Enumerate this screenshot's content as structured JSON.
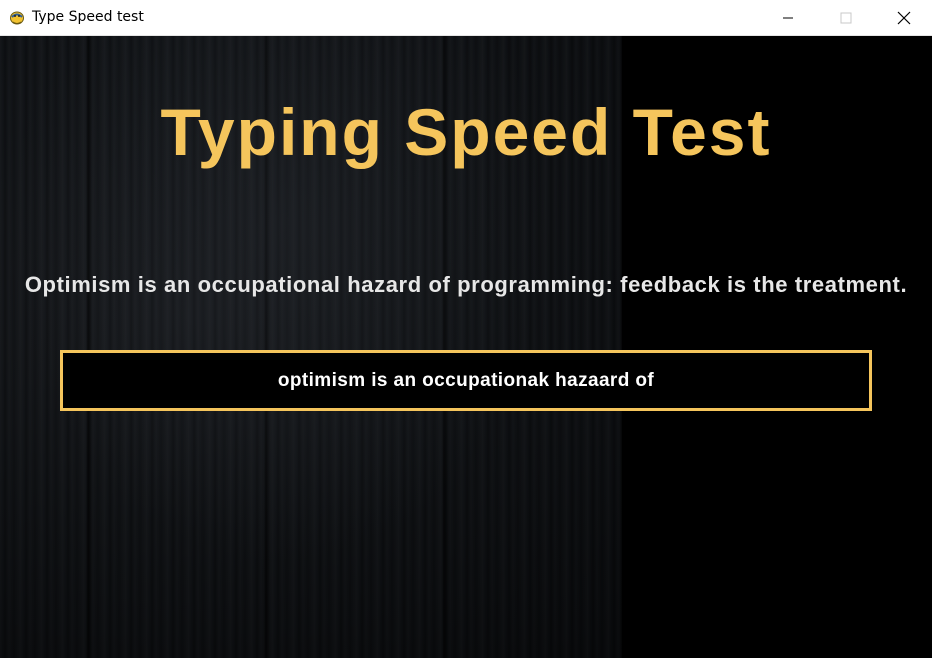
{
  "window": {
    "title": "Type Speed test",
    "icon": "pygame-snake-icon"
  },
  "controls": {
    "minimize_icon": "minimize-icon",
    "maximize_icon": "maximize-icon",
    "close_icon": "close-icon"
  },
  "game": {
    "heading": "Typing Speed Test",
    "sentence": "Optimism is an occupational hazard of programming: feedback is the treatment.",
    "typed_text": "optimism is an occupationak hazaard of"
  },
  "colors": {
    "accent": "#f5c55c",
    "sentence_text": "#e7e7e7",
    "typed_text": "#ffffff",
    "background": "#000000"
  }
}
